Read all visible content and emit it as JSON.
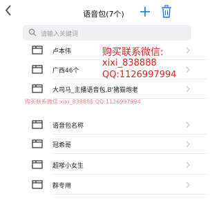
{
  "header": {
    "title": "语音包(7个)"
  },
  "search": {
    "placeholder": "请输入关键词"
  },
  "folders": [
    {
      "label": "卢本伟"
    },
    {
      "label": "广西46个"
    },
    {
      "label": "大司马_主播语音包,B'猪猫炮老"
    },
    {
      "label": "语音包名称"
    },
    {
      "label": "冠希哥"
    },
    {
      "label": "超嗲小女生"
    },
    {
      "label": "群专用"
    }
  ],
  "overlay": {
    "line1": "购买联系微信:",
    "line2": "xixi_838888",
    "line3": "QQ:1126997994",
    "line4": "购买联系微信:xixi_838888 QQ:1126997994"
  },
  "colors": {
    "accent": "#1a73e8",
    "watermark": "#e02020",
    "search_bg": "#efeff4"
  },
  "icons": {
    "back": "chevron-left-icon",
    "add": "plus-icon",
    "delete": "trash-icon",
    "search": "magnifier-icon",
    "folder": "folder-icon",
    "row_arrow": "chevron-right-icon"
  }
}
